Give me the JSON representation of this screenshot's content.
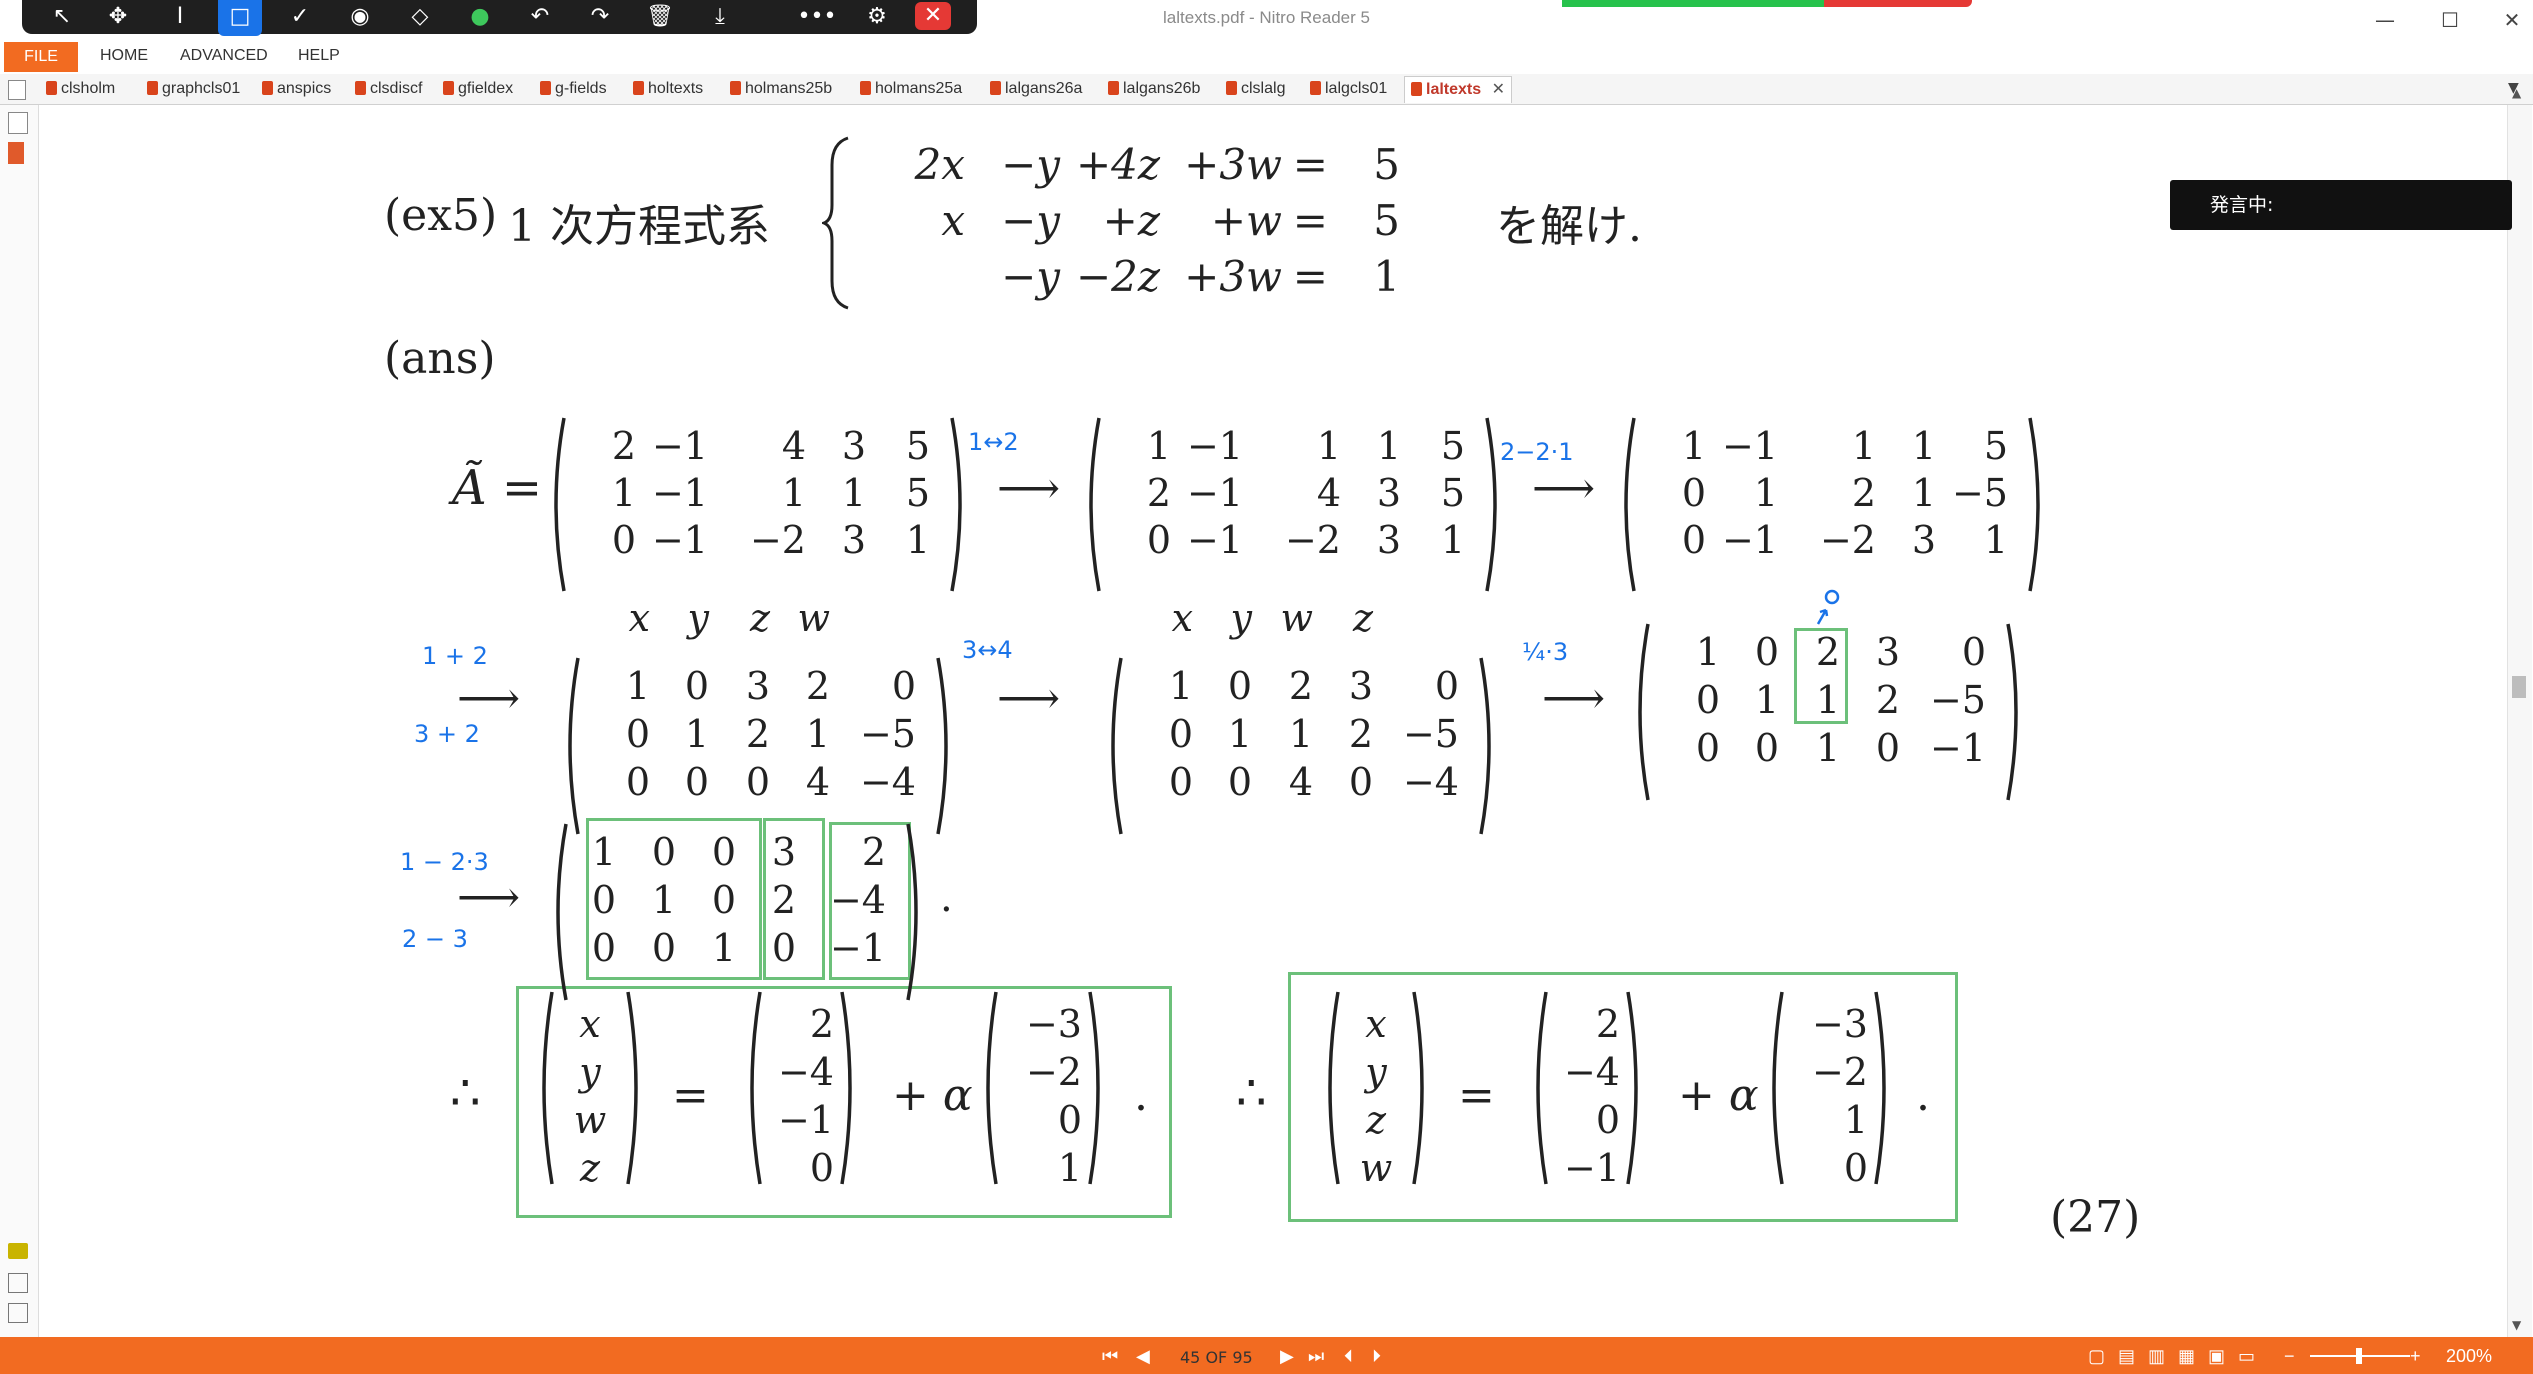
{
  "window": {
    "title": "laltexts.pdf - Nitro Reader 5",
    "minimize": "—",
    "maximize": "☐",
    "close": "✕"
  },
  "toolbar": {
    "close_icon": "✕"
  },
  "menu": {
    "file": "FILE",
    "home": "HOME",
    "advanced": "ADVANCED",
    "help": "HELP"
  },
  "tabs": [
    "clsholm",
    "graphcls01",
    "anspics",
    "clsdiscf",
    "gfieldex",
    "g-fields",
    "holtexts",
    "holmans25b",
    "holmans25a",
    "lalgans26a",
    "lalgans26b",
    "clslalg",
    "lalgcls01",
    "laltexts"
  ],
  "tab_close": "✕",
  "speech": {
    "label": "発言中:"
  },
  "status": {
    "page": "45 OF 95",
    "zoom": "200%"
  },
  "doc": {
    "ex_label": "(ex5)",
    "ex_text": "1 次方程式系",
    "ex_suffix": "を解け.",
    "system": [
      [
        "2x",
        "−y",
        "+4z",
        "+3w",
        "=",
        "5"
      ],
      [
        "x",
        "−y",
        "+z",
        "+w",
        "=",
        "5"
      ],
      [
        "",
        "−y",
        "−2z",
        "+3w",
        "=",
        "1"
      ]
    ],
    "ans": "(ans)",
    "A_label": "Ã =",
    "m1": [
      [
        "2",
        "−1",
        "4",
        "3",
        "5"
      ],
      [
        "1",
        "−1",
        "1",
        "1",
        "5"
      ],
      [
        "0",
        "−1",
        "−2",
        "3",
        "1"
      ]
    ],
    "m2": [
      [
        "1",
        "−1",
        "1",
        "1",
        "5"
      ],
      [
        "2",
        "−1",
        "4",
        "3",
        "5"
      ],
      [
        "0",
        "−1",
        "−2",
        "3",
        "1"
      ]
    ],
    "m3": [
      [
        "1",
        "−1",
        "1",
        "1",
        "5"
      ],
      [
        "0",
        "1",
        "2",
        "1",
        "−5"
      ],
      [
        "0",
        "−1",
        "−2",
        "3",
        "1"
      ]
    ],
    "m4_header": [
      "x",
      "y",
      "z",
      "w"
    ],
    "m4": [
      [
        "1",
        "0",
        "3",
        "2",
        "0"
      ],
      [
        "0",
        "1",
        "2",
        "1",
        "−5"
      ],
      [
        "0",
        "0",
        "0",
        "4",
        "−4"
      ]
    ],
    "m5_header": [
      "x",
      "y",
      "w",
      "z"
    ],
    "m5": [
      [
        "1",
        "0",
        "2",
        "3",
        "0"
      ],
      [
        "0",
        "1",
        "1",
        "2",
        "−5"
      ],
      [
        "0",
        "0",
        "4",
        "0",
        "−4"
      ]
    ],
    "m6": [
      [
        "1",
        "0",
        "2",
        "3",
        "0"
      ],
      [
        "0",
        "1",
        "1",
        "2",
        "−5"
      ],
      [
        "0",
        "0",
        "1",
        "0",
        "−1"
      ]
    ],
    "m7": [
      [
        "1",
        "0",
        "0",
        "3",
        "2"
      ],
      [
        "0",
        "1",
        "0",
        "2",
        "−4"
      ],
      [
        "0",
        "0",
        "1",
        "0",
        "−1"
      ]
    ],
    "sol1": {
      "therefore": "∴",
      "vars": [
        "x",
        "y",
        "w",
        "z"
      ],
      "eq": "=",
      "v": [
        "2",
        "−4",
        "−1",
        "0"
      ],
      "plus": "+ α",
      "d": [
        "−3",
        "−2",
        "0",
        "1"
      ],
      "dot": "."
    },
    "sol2": {
      "therefore": "∴",
      "vars": [
        "x",
        "y",
        "z",
        "w"
      ],
      "eq": "=",
      "v": [
        "2",
        "−4",
        "0",
        "−1"
      ],
      "plus": "+ α",
      "d": [
        "−3",
        "−2",
        "1",
        "0"
      ],
      "dot": "."
    },
    "eq_number": "(27)",
    "annotations": {
      "a1": "1↔2",
      "a2": "2−2·1",
      "a3a": "1 + 2",
      "a3b": "3 + 2",
      "a4": "3↔4",
      "a5": "¼·3",
      "a6a": "1 − 2·3",
      "a6b": "2 − 3",
      "arrow": "⟶"
    }
  }
}
